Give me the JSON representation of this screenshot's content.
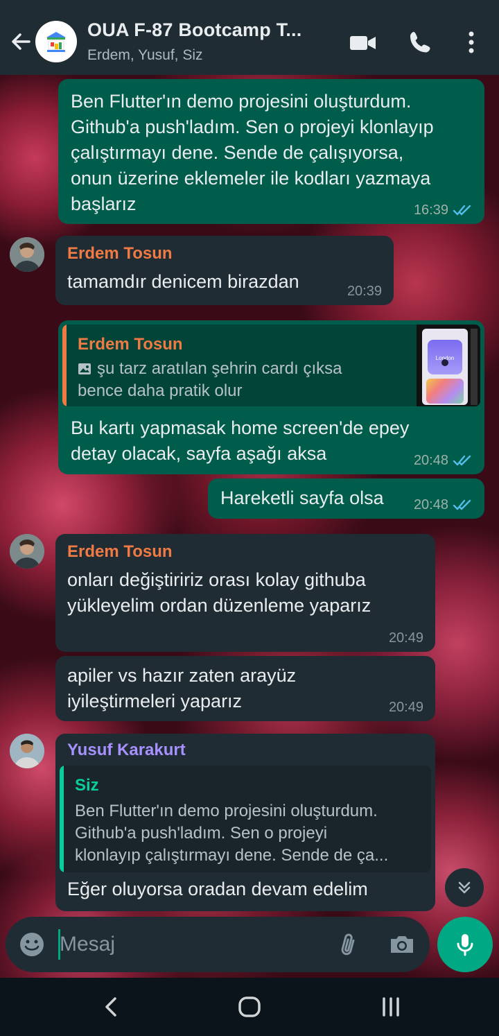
{
  "header": {
    "title": "OUA F-87 Bootcamp T...",
    "subtitle": "Erdem, Yusuf, Siz"
  },
  "icons": {
    "back": "arrow-left-icon",
    "video": "video-call-icon",
    "call": "phone-icon",
    "menu": "more-vertical-icon",
    "read": "double-check-icon",
    "emoji": "emoji-icon",
    "attach": "paperclip-icon",
    "camera": "camera-icon",
    "mic": "microphone-icon",
    "scroll": "double-chevron-down-icon"
  },
  "colors": {
    "outgoing_bubble": "#005c4b",
    "incoming_bubble": "#202c33",
    "accent": "#00a884",
    "read_ticks": "#53bdeb",
    "sender_erdem": "#f07a44",
    "sender_yusuf": "#a791ff",
    "quote_self": "#06cf9c"
  },
  "messages": [
    {
      "direction": "out",
      "text": "Ben Flutter'ın demo projesini oluşturdum.\nGithub'a push'ladım. Sen o projeyi klonlayıp\nçalıştırmayı dene. Sende de çalışıyorsa,\nonun üzerine eklemeler ile kodları yazmaya\nbaşlarız",
      "time": "16:39"
    },
    {
      "direction": "in",
      "sender": "Erdem Tosun",
      "text": "tamamdır denicem birazdan",
      "time": "20:39"
    },
    {
      "direction": "out",
      "quote": {
        "author": "Erdem Tosun",
        "text": "şu tarz aratılan şehrin cardı çıksa\nbence daha pratik olur",
        "thumb_label": "London"
      },
      "text": "Bu kartı yapmasak home screen'de epey\ndetay olacak, sayfa aşağı aksa",
      "time": "20:48"
    },
    {
      "direction": "out",
      "text": "Hareketli sayfa olsa",
      "time": "20:48"
    },
    {
      "direction": "in",
      "sender": "Erdem Tosun",
      "text": "onları değiştiririz orası kolay githuba\nyükleyelim ordan düzenleme yaparız",
      "time": "20:49"
    },
    {
      "direction": "in",
      "text": "apiler vs hazır zaten arayüz\niyileştirmeleri yaparız",
      "time": "20:49"
    },
    {
      "direction": "in",
      "sender": "Yusuf Karakurt",
      "quote": {
        "author": "Siz",
        "text": "Ben Flutter'ın demo projesini oluşturdum.\nGithub'a push'ladım. Sen o projeyi\nklonlayıp çalıştırmayı dene. Sende de ça..."
      },
      "text": "Eğer oluyorsa oradan devam edelim"
    }
  ],
  "input": {
    "placeholder": "Mesaj"
  }
}
